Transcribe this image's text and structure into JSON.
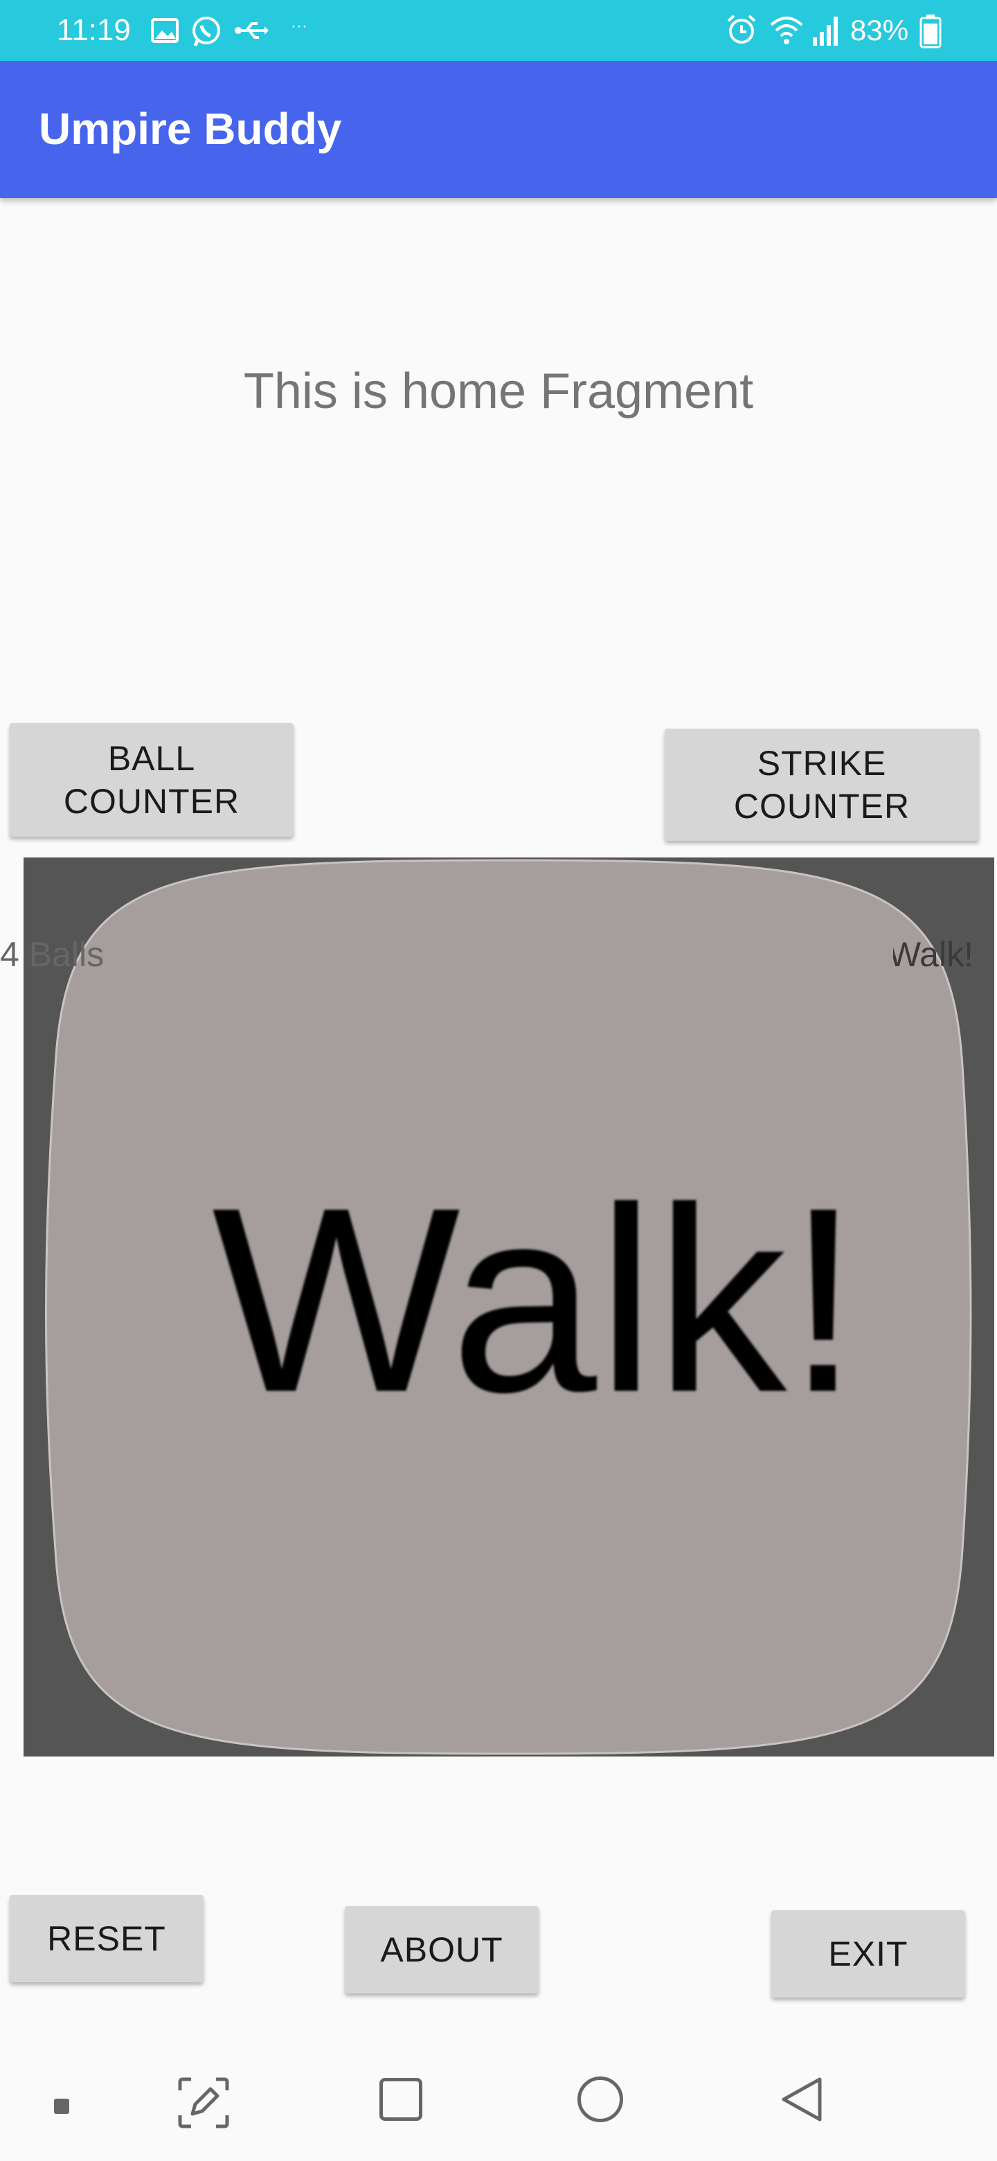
{
  "status_bar": {
    "time": "11:19",
    "battery": "83%",
    "left_icons": [
      "image-icon",
      "whatsapp-icon",
      "usb-icon",
      "more-dots-icon"
    ],
    "right_icons": [
      "alarm-icon",
      "wifi-icon",
      "signal-icon",
      "battery-icon"
    ]
  },
  "app_bar": {
    "title": "Umpire Buddy"
  },
  "main": {
    "fragment_text": "This is home Fragment",
    "ball_counter_label": "BALL\nCOUNTER",
    "strike_counter_label": "STRIKE\nCOUNTER",
    "balls_text": "4 Balls",
    "walk_overlay_text": "Walk!",
    "walk_image_text": "Walk!"
  },
  "bottom_buttons": {
    "reset": "RESET",
    "about": "ABOUT",
    "exit": "EXIT"
  },
  "nav_bar": {
    "icons": [
      "small-square-icon",
      "screenshot-edit-icon",
      "recents-icon",
      "home-icon",
      "back-icon"
    ]
  },
  "colors": {
    "status_bar": "#27c9dd",
    "app_bar": "#4664ec",
    "button": "#d6d6d6",
    "image_background": "#555555",
    "image_card": "#a69e9d"
  }
}
